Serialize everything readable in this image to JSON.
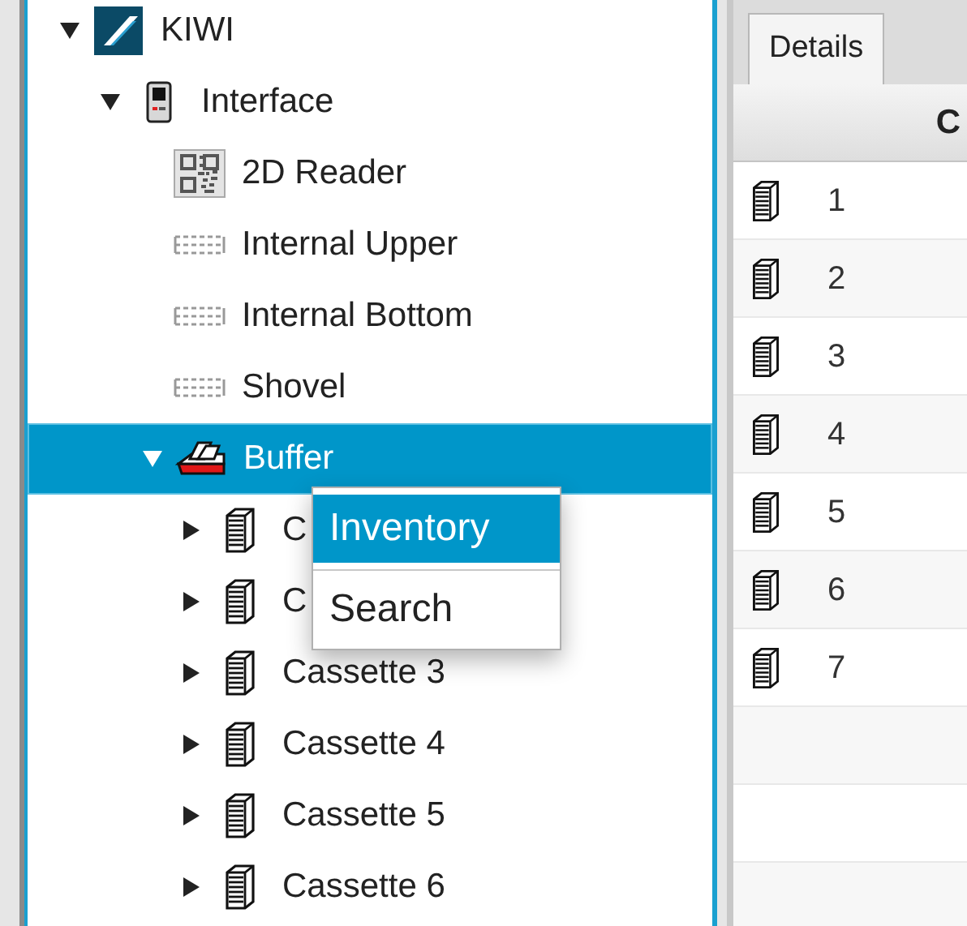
{
  "tree": [
    {
      "label": "KIWI",
      "kind": "logo",
      "expanded": true,
      "selected": false,
      "children": [
        {
          "label": "Interface",
          "kind": "device",
          "expanded": true,
          "selected": false,
          "children": [
            {
              "label": "2D Reader",
              "kind": "reader",
              "selected": false
            },
            {
              "label": "Internal Upper",
              "kind": "rack",
              "selected": false
            },
            {
              "label": "Internal Bottom",
              "kind": "rack",
              "selected": false
            },
            {
              "label": "Shovel",
              "kind": "rack",
              "selected": false
            },
            {
              "label": "Buffer",
              "kind": "buffer",
              "expanded": true,
              "selected": true,
              "children": [
                {
                  "label": "C",
                  "kind": "cassette",
                  "expanded": false,
                  "selected": false
                },
                {
                  "label": "C",
                  "kind": "cassette",
                  "expanded": false,
                  "selected": false
                },
                {
                  "label": "Cassette 3",
                  "kind": "cassette",
                  "expanded": false,
                  "selected": false
                },
                {
                  "label": "Cassette 4",
                  "kind": "cassette",
                  "expanded": false,
                  "selected": false
                },
                {
                  "label": "Cassette 5",
                  "kind": "cassette",
                  "expanded": false,
                  "selected": false
                },
                {
                  "label": "Cassette 6",
                  "kind": "cassette",
                  "expanded": false,
                  "selected": false
                }
              ]
            }
          ]
        }
      ]
    }
  ],
  "context_menu": {
    "items": [
      {
        "label": "Inventory",
        "selected": true
      },
      {
        "label": "Search",
        "selected": false
      }
    ]
  },
  "details": {
    "tabs": [
      {
        "label": "Details",
        "selected": true
      }
    ],
    "table": {
      "columns": [
        "C"
      ],
      "rows": [
        {
          "label": "1"
        },
        {
          "label": "2"
        },
        {
          "label": "3"
        },
        {
          "label": "4"
        },
        {
          "label": "5"
        },
        {
          "label": "6"
        },
        {
          "label": "7"
        }
      ]
    }
  }
}
